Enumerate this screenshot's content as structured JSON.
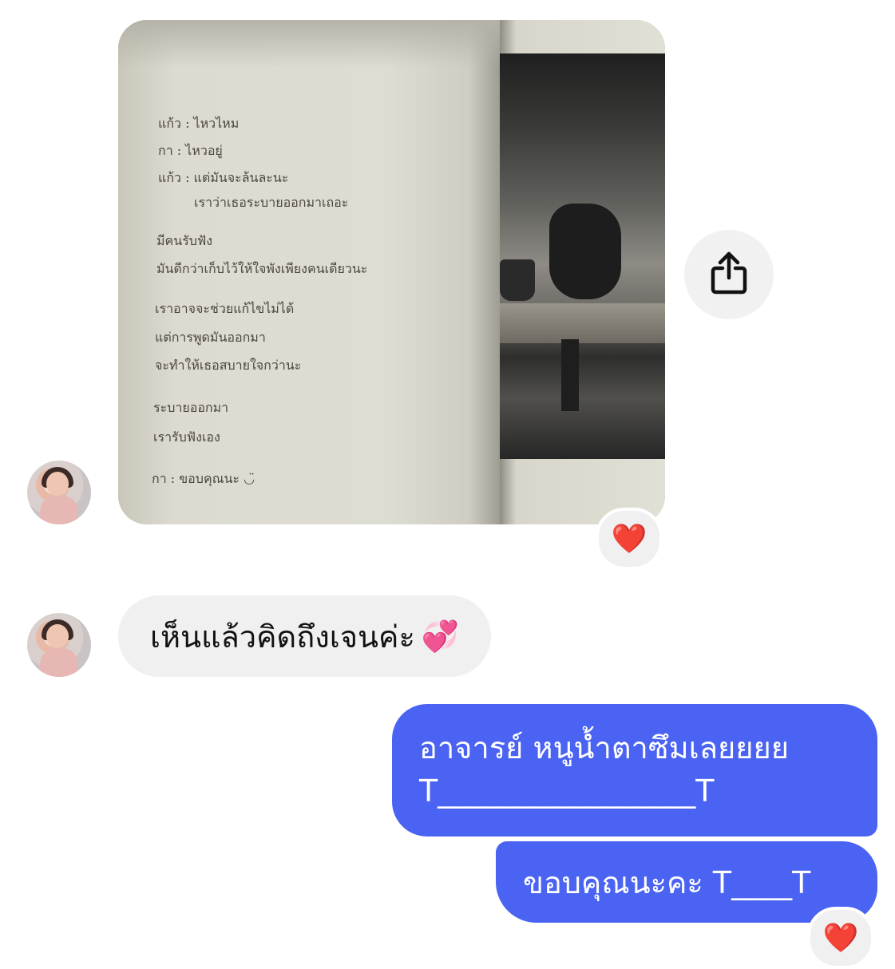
{
  "photo_message": {
    "poem_lines": [
      "แก้ว : ไหวไหม",
      "กา : ไหวอยู่",
      "แก้ว : แต่มันจะล้นละนะ",
      "เราว่าเธอระบายออกมาเถอะ",
      "มีคนรับฟัง",
      "มันดีกว่าเก็บไว้ให้ใจพังเพียงคนเดียวนะ",
      "เราอาจจะช่วยแก้ไขไม่ได้",
      "แต่การพูดมันออกมา",
      "จะทำให้เธอสบายใจกว่านะ",
      "ระบายออกมา",
      "เรารับฟังเอง",
      "กา : ขอบคุณนะ ◡̈"
    ],
    "reaction": "❤️"
  },
  "incoming_message": {
    "text": "เห็นแล้วคิดถึงเจนค่ะ",
    "emoji": "💞"
  },
  "outgoing_messages": [
    {
      "line1": "อาจารย์ หนูน้ำตาซึมเลยยยย",
      "line2": "T_________________T"
    },
    {
      "line1": "ขอบคุณนะคะ T____T"
    }
  ],
  "outgoing_reaction": "❤️",
  "icons": {
    "share": "share-icon",
    "heart": "heart-icon"
  },
  "colors": {
    "outgoing_bubble": "#4a63f2",
    "incoming_bubble": "#f0f0f0",
    "heart": "#e0202a"
  }
}
